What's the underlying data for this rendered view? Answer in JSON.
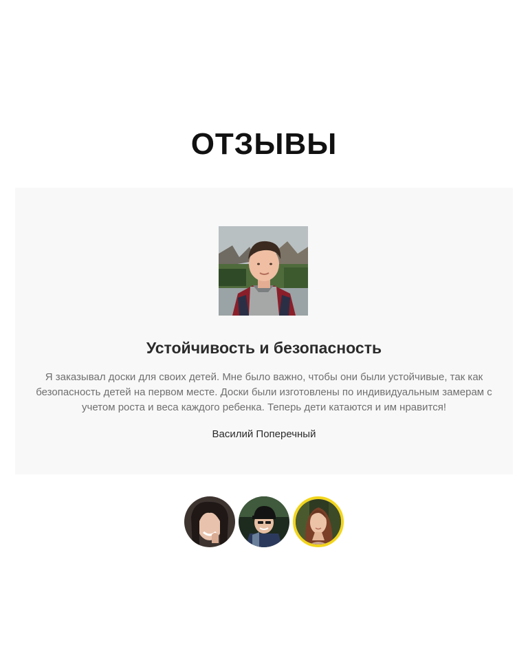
{
  "section": {
    "title": "ОТЗЫВЫ"
  },
  "review": {
    "heading": "Устойчивость и безопасность",
    "text": "Я заказывал доски для своих детей. Мне было важно, чтобы они были устойчивые, так как безопасность детей на первом месте. Доски были изготовлены по индивидуальным замерам с учетом роста и веса каждого ребенка. Теперь дети катаются и им нравится!",
    "author": "Василий Поперечный"
  },
  "colors": {
    "card_background": "#f7f8f7",
    "active_avatar_border": "#f2d51c",
    "title": "#111111",
    "body_text": "#6f6f6f"
  }
}
